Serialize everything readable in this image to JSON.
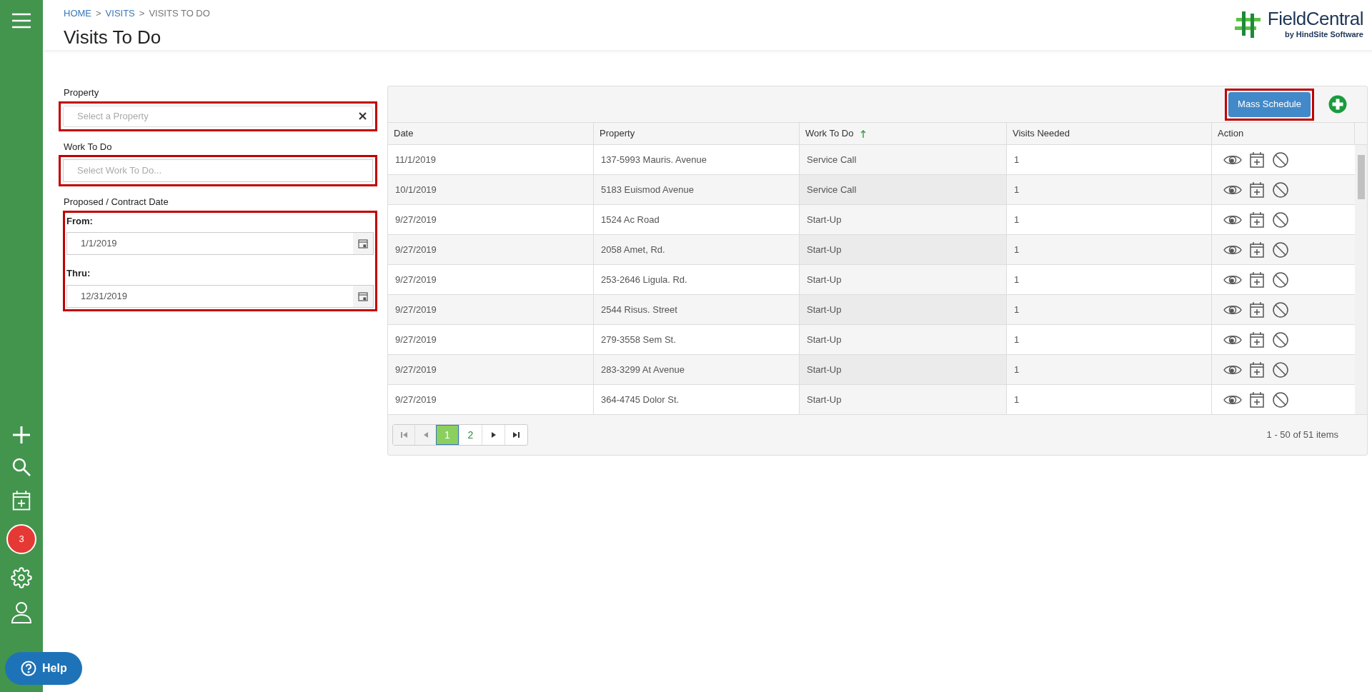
{
  "breadcrumb": [
    {
      "label": "HOME",
      "link": true
    },
    {
      "separator": ">",
      "label": "VISITS",
      "link": true
    },
    {
      "separator": ">",
      "label": "VISITS TO DO",
      "link": false
    }
  ],
  "title": "Visits To Do",
  "logo": {
    "name": "FieldCentral",
    "tagline": "by HindSite Software"
  },
  "sidebar": {
    "badge": "3",
    "help": "Help"
  },
  "filters": {
    "property": {
      "label": "Property",
      "placeholder": "Select a Property",
      "highlighted": true
    },
    "work_to_do": {
      "label": "Work To Do",
      "placeholder": "Select Work To Do...",
      "highlighted": true
    },
    "date_group": {
      "label": "Proposed / Contract Date",
      "highlighted": true,
      "from_label": "From:",
      "from": "1/1/2019",
      "thru_label": "Thru:",
      "thru": "12/31/2019"
    }
  },
  "toolbar": {
    "mass_schedule": "Mass Schedule",
    "highlighted": true
  },
  "table": {
    "columns": [
      {
        "label": "Date",
        "sorted": false
      },
      {
        "label": "Property",
        "sorted": false
      },
      {
        "label": "Work To Do",
        "sorted": true
      },
      {
        "label": "Visits Needed",
        "sorted": false
      },
      {
        "label": "Action",
        "sorted": false
      }
    ],
    "rows": [
      {
        "date": "11/1/2019",
        "property": "137-5993 Mauris. Avenue",
        "work": "Service Call",
        "visits": "1"
      },
      {
        "date": "10/1/2019",
        "property": "5183 Euismod Avenue",
        "work": "Service Call",
        "visits": "1"
      },
      {
        "date": "9/27/2019",
        "property": "1524 Ac Road",
        "work": "Start-Up",
        "visits": "1"
      },
      {
        "date": "9/27/2019",
        "property": "2058 Amet, Rd.",
        "work": "Start-Up",
        "visits": "1"
      },
      {
        "date": "9/27/2019",
        "property": "253-2646 Ligula. Rd.",
        "work": "Start-Up",
        "visits": "1"
      },
      {
        "date": "9/27/2019",
        "property": "2544 Risus. Street",
        "work": "Start-Up",
        "visits": "1"
      },
      {
        "date": "9/27/2019",
        "property": "279-3558 Sem St.",
        "work": "Start-Up",
        "visits": "1"
      },
      {
        "date": "9/27/2019",
        "property": "283-3299 At Avenue",
        "work": "Start-Up",
        "visits": "1"
      },
      {
        "date": "9/27/2019",
        "property": "364-4745 Dolor St.",
        "work": "Start-Up",
        "visits": "1"
      }
    ]
  },
  "pager": {
    "pages": [
      {
        "label": "1",
        "selected": true
      },
      {
        "label": "2",
        "selected": false
      }
    ],
    "summary": "1 - 50 of 51 items"
  }
}
